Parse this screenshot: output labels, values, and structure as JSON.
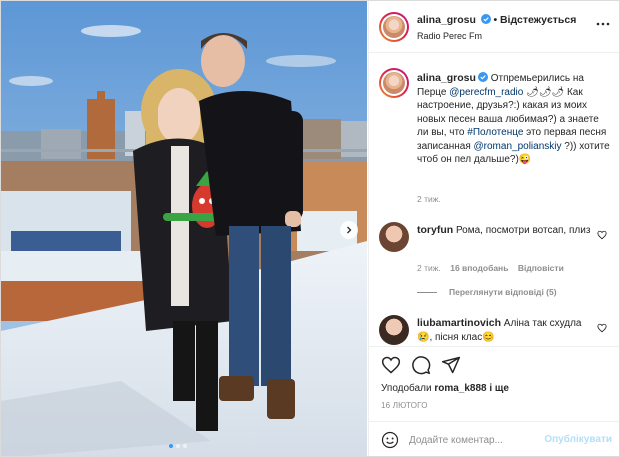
{
  "post": {
    "author": "alina_grosu",
    "follow_label": "Відстежується",
    "follow_separator": "•",
    "location": "Radio Perec Fm"
  },
  "caption": {
    "author": "alina_grosu",
    "part1": "Отпремьерились на Перце ",
    "mention1": "@perecfm_radio",
    "part2": " 🌶🌶🌶 Как настроение, друзья?:) какая из моих новых песен ваша любимая?) а знаете ли вы, что ",
    "hashtag": "#Полотенце",
    "part3": " это первая песня записанная ",
    "mention2": "@roman_polianskiy",
    "part4": " ?)) хотите чтоб он пел дальше?)😜",
    "time": "2 тиж."
  },
  "comments": [
    {
      "author": "toryfun",
      "text": "Рома, посмотри вотсап, плиз",
      "time": "2 тиж.",
      "likes": "16 вподобань",
      "reply": "Відповісти",
      "view_replies": "Переглянути відповіді (5)"
    },
    {
      "author": "liubamartinovich",
      "text": "Аліна так схудла😢, пісня клас😊"
    }
  ],
  "likes": {
    "prefix": "Уподобали",
    "user": "roma_k888",
    "suffix": "і ще"
  },
  "date": "16 ЛЮТОГО",
  "comment_box": {
    "placeholder": "Додайте коментар...",
    "publish_label": "Опублікувати"
  },
  "icons": {
    "verified": "verified-badge-icon",
    "more": "more-options-icon",
    "like": "heart-icon",
    "comment": "comment-icon",
    "share": "share-icon",
    "emoji": "emoji-icon",
    "next": "chevron-right-icon"
  },
  "colors": {
    "verified_blue": "#3897f0",
    "link": "#00376b",
    "muted": "#8e8e8e",
    "publish_disabled": "#b2dffc"
  },
  "carousel": {
    "slides": 3,
    "active": 0
  }
}
